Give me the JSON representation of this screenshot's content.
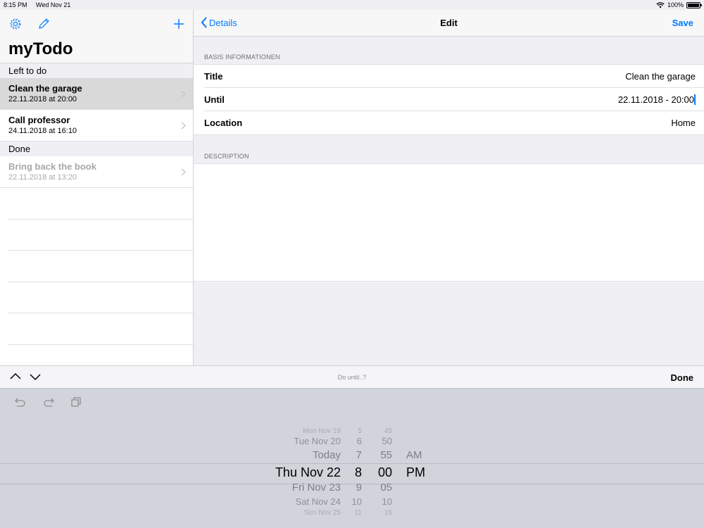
{
  "status_bar": {
    "time": "8:15 PM",
    "date": "Wed Nov 21",
    "battery": "100%"
  },
  "master": {
    "title": "myTodo",
    "sections": [
      {
        "header": "Left to do",
        "items": [
          {
            "title": "Clean the garage",
            "subtitle": "22.11.2018 at 20:00",
            "selected": true
          },
          {
            "title": "Call professor",
            "subtitle": "24.11.2018 at 16:10",
            "selected": false
          }
        ]
      },
      {
        "header": "Done",
        "items": [
          {
            "title": "Bring back the book",
            "subtitle": "22.11.2018 at 13:20",
            "selected": false
          }
        ]
      }
    ]
  },
  "detail": {
    "back_label": "Details",
    "title": "Edit",
    "save_label": "Save",
    "basis_label": "BASIS INFORMATIONEN",
    "fields": [
      {
        "label": "Title",
        "value": "Clean the garage"
      },
      {
        "label": "Until",
        "value": "22.11.2018 - 20:00"
      },
      {
        "label": "Location",
        "value": "Home"
      }
    ],
    "description_label": "DESCRIPTION"
  },
  "accessory": {
    "prompt": "Do until..?",
    "done_label": "Done"
  },
  "picker": {
    "dates": [
      "Mon Nov 19",
      "Tue Nov 20",
      "Today",
      "Thu Nov 22",
      "Fri Nov 23",
      "Sat Nov 24",
      "Sun Nov 25"
    ],
    "hours": [
      "5",
      "6",
      "7",
      "8",
      "9",
      "10",
      "11"
    ],
    "minutes": [
      "45",
      "50",
      "55",
      "00",
      "05",
      "10",
      "15"
    ],
    "ampm": [
      "AM",
      "PM"
    ],
    "selected": {
      "date": "Thu Nov 22",
      "hour": "8",
      "minute": "00",
      "ampm": "PM"
    }
  },
  "colors": {
    "accent": "#007aff",
    "selected_row": "#d9d9d9",
    "keyboard_bg": "#d1d4da"
  }
}
